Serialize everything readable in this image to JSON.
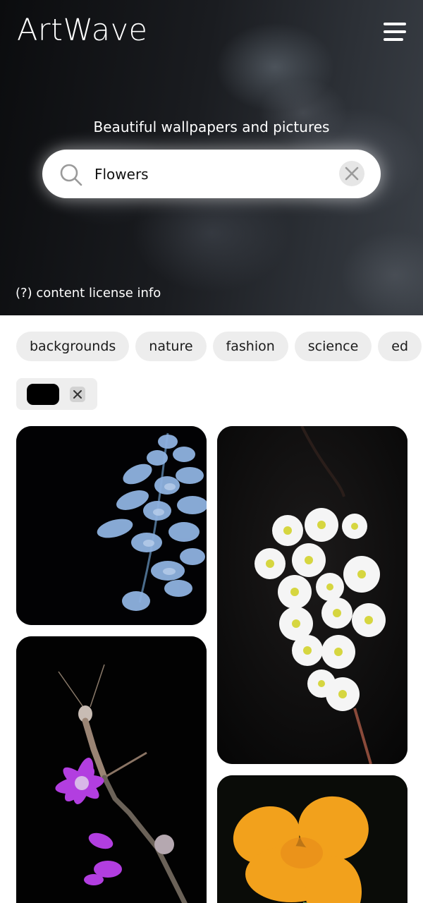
{
  "app": {
    "title": "ArtWave"
  },
  "hero": {
    "tagline": "Beautiful wallpapers and pictures",
    "license_link": "(?) content license info"
  },
  "search": {
    "value": "Flowers",
    "placeholder": ""
  },
  "tags": [
    "backgrounds",
    "nature",
    "fashion",
    "science",
    "ed"
  ],
  "color_filter": {
    "color": "#000000"
  },
  "icons": {
    "menu": "hamburger-menu-icon",
    "search": "search-icon",
    "clear": "close-icon",
    "remove_filter": "close-icon"
  },
  "colors": {
    "accent": "#ffffff",
    "chip_bg": "#ededed",
    "flower_blue": "#7fa3d8",
    "flower_purple": "#b23ee0",
    "flower_orange": "#f2a11c"
  }
}
